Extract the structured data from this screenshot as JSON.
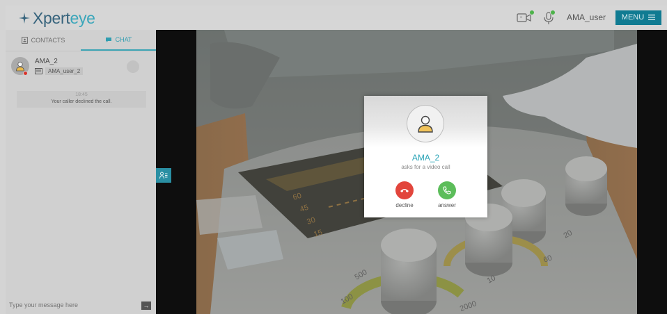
{
  "app": {
    "logo_prefix": "Xpert",
    "logo_suffix": "eye",
    "brand_color": "#36637c",
    "accent": "#3aa6ba"
  },
  "header": {
    "username": "AMA_user",
    "menu_label": "MENU",
    "camera_icon": "video-camera-icon",
    "mic_icon": "microphone-icon"
  },
  "sidebar": {
    "tabs": [
      {
        "label": "CONTACTS",
        "icon": "contacts-icon",
        "active": false
      },
      {
        "label": "CHAT",
        "icon": "chat-bubble-icon",
        "active": true
      }
    ],
    "contact": {
      "name": "AMA_2",
      "device": "AMA_user_2",
      "status_color": "#d9332b"
    },
    "notice": {
      "time": "18:45",
      "text": "Your caller declined the call."
    },
    "message_placeholder": "Type your message here"
  },
  "modal": {
    "caller": "AMA_2",
    "subtitle": "asks for a video call",
    "decline_label": "decline",
    "answer_label": "answer",
    "decline_color": "#e2453c",
    "answer_color": "#5cbd5a"
  }
}
